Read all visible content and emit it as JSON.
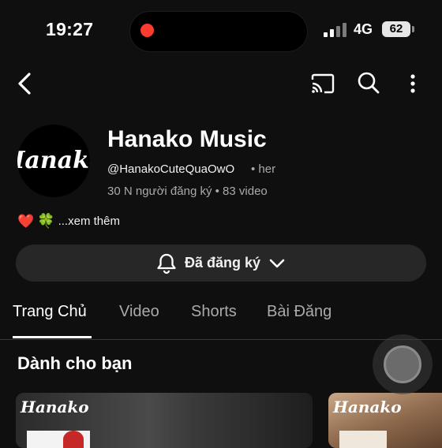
{
  "status_bar": {
    "time": "19:27",
    "network": "4G",
    "battery": "62",
    "recording_color": "#ff3b30"
  },
  "nav": {
    "icons": [
      "back-arrow-icon",
      "cast-icon",
      "search-icon",
      "more-vertical-icon"
    ]
  },
  "channel": {
    "avatar_logo_text": "Hanako",
    "name": "Hanako Music",
    "handle": "@HanakoCuteQuaOwO",
    "handle_more": "• her",
    "stats": "30 N người đăng ký • 83 video",
    "description_more": "...xem thêm",
    "description_emojis": [
      "❤️",
      "🍀"
    ]
  },
  "subscribe_button": {
    "label": "Đã đăng ký",
    "icon": "bell-icon"
  },
  "tabs": [
    {
      "label": "Trang Chủ",
      "active": true
    },
    {
      "label": "Video",
      "active": false
    },
    {
      "label": "Shorts",
      "active": false
    },
    {
      "label": "Bài Đăng",
      "active": false
    }
  ],
  "section": {
    "title": "Dành cho bạn"
  },
  "cards": [
    {
      "logo_text": "Hanako"
    },
    {
      "logo_text": "Hanako"
    }
  ],
  "colors": {
    "background": "#0f0f0f",
    "button_bg": "#272727",
    "muted_text": "#aaaaaa",
    "heart": "#e53935",
    "clover": "#2e9b3c"
  }
}
